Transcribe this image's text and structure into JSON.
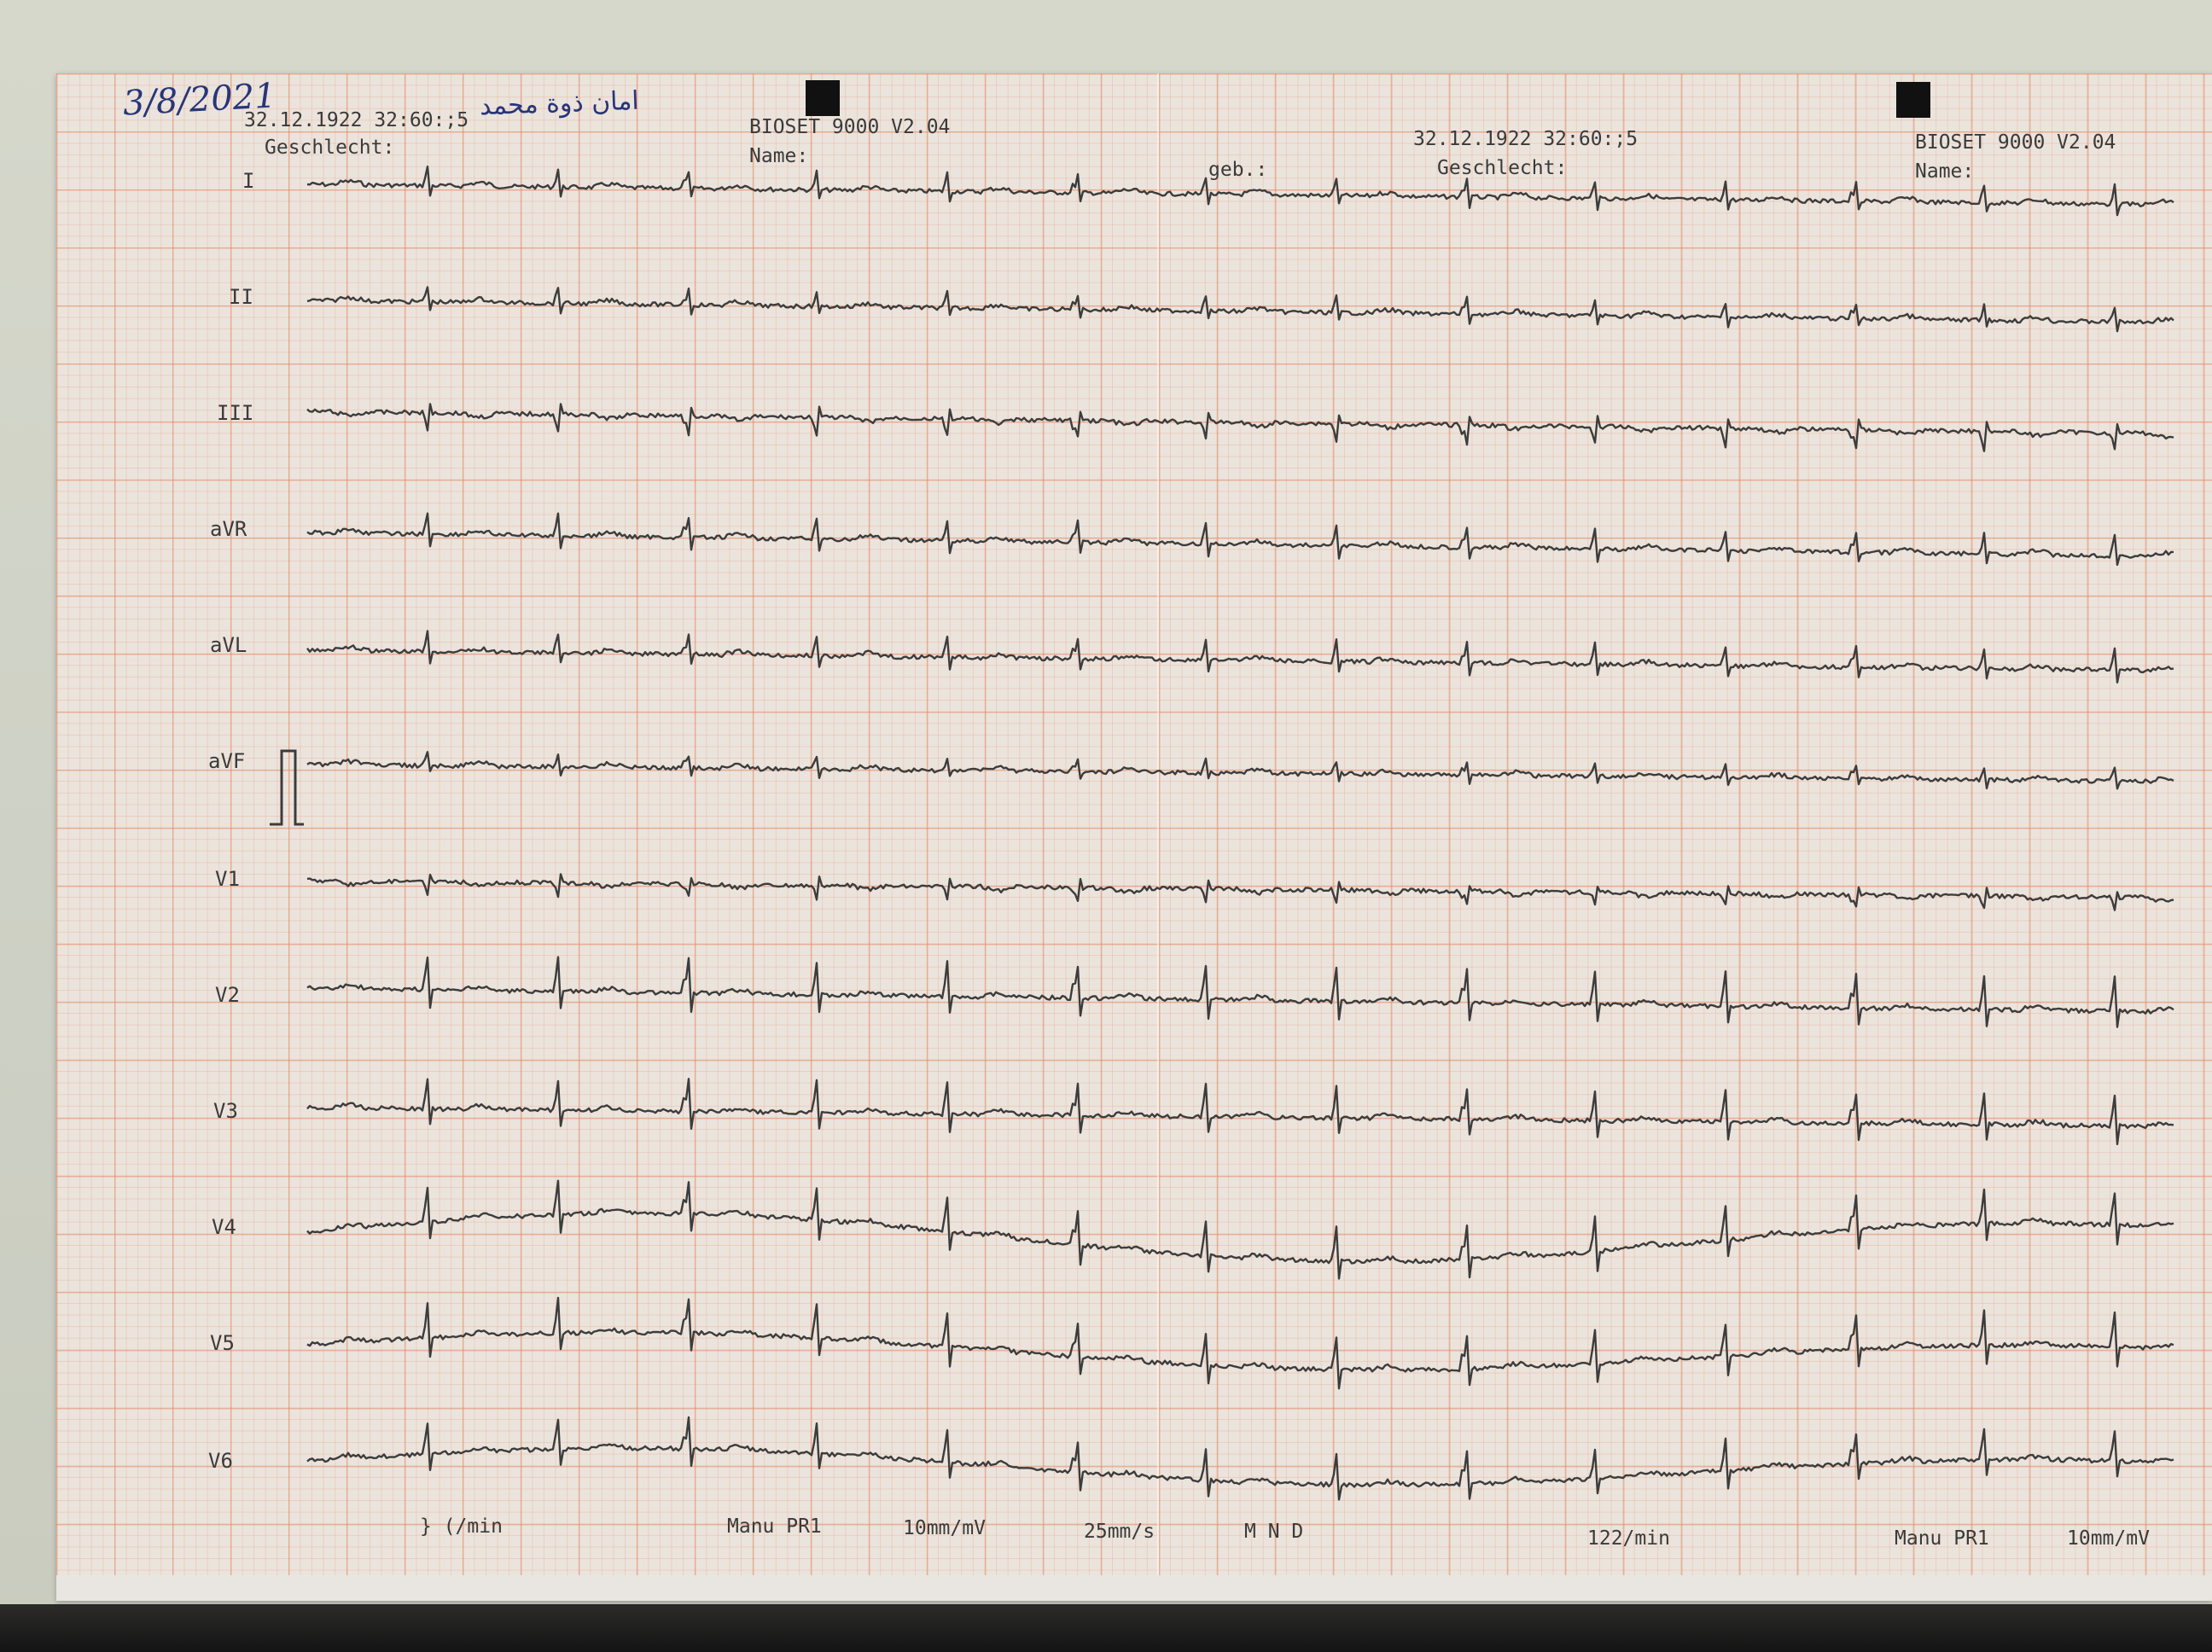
{
  "handwritten": {
    "date": "3/8/2021",
    "name": "امان ذوة محمد"
  },
  "header_left": {
    "datetime": "32.12.1922 32:60:;5",
    "sex_label": "Geschlecht:",
    "device": "BIOSET 9000 V2.04",
    "name_label": "Name:",
    "dob_label": "geb.:"
  },
  "header_right": {
    "datetime": "32.12.1922 32:60:;5",
    "sex_label": "Geschlecht:",
    "device": "BIOSET 9000 V2.04",
    "name_label": "Name:"
  },
  "leads": [
    "I",
    "II",
    "III",
    "aVR",
    "aVL",
    "aVF",
    "V1",
    "V2",
    "V3",
    "V4",
    "V5",
    "V6"
  ],
  "footer": {
    "rate_left": "} (/min",
    "mode_left": "Manu PR1",
    "gain_left": "10mm/mV",
    "speed": "25mm/s",
    "filters": "M  N  D",
    "rate_right": "122/min",
    "mode_right": "Manu PR1",
    "gain_right": "10mm/mV"
  },
  "colors": {
    "trace": "#3c3c3c",
    "grid_major": "#e28c69",
    "grid_minor": "#e6a587",
    "ink": "#27357a"
  }
}
